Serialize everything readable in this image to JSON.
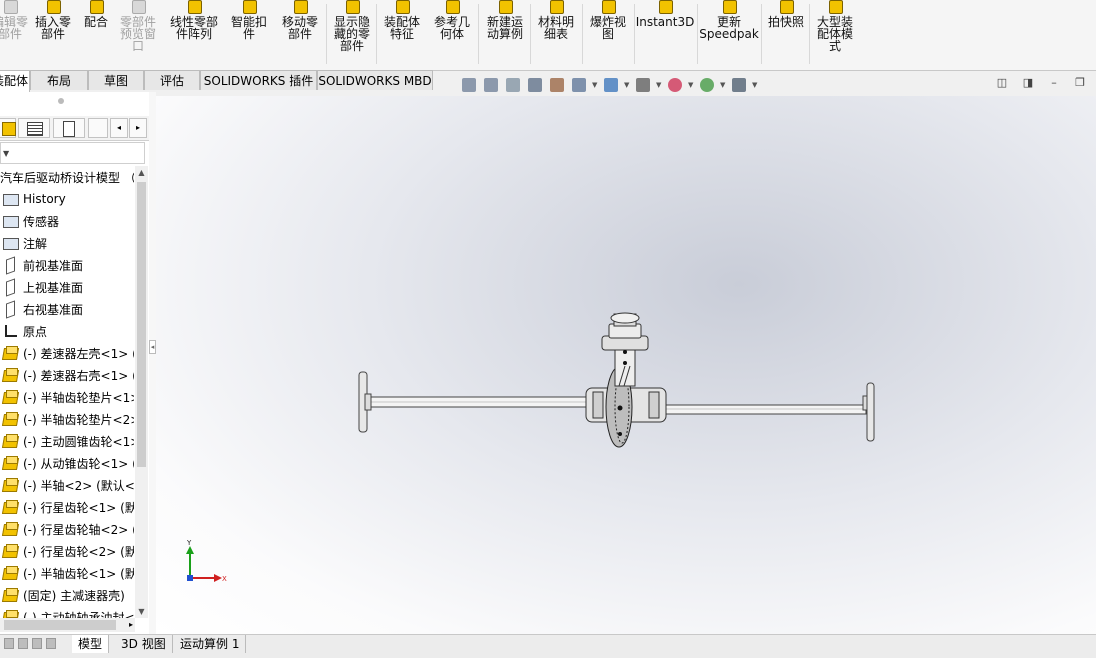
{
  "ribbon": {
    "buttons": [
      {
        "label": "编辑零\n部件",
        "icon": "edit-component-icon",
        "enabled": false
      },
      {
        "label": "插入零\n部件",
        "icon": "insert-component-icon",
        "enabled": true
      },
      {
        "label": "配合",
        "icon": "mate-icon",
        "enabled": true
      },
      {
        "label": "零部件\n预览窗\n口",
        "icon": "component-preview-icon",
        "enabled": false
      },
      {
        "label": "线性零部\n件阵列",
        "icon": "linear-pattern-icon",
        "enabled": true
      },
      {
        "label": "智能扣\n件",
        "icon": "smart-fasteners-icon",
        "enabled": true
      },
      {
        "label": "移动零\n部件",
        "icon": "move-component-icon",
        "enabled": true
      },
      {
        "label": "显示隐\n藏的零\n部件",
        "icon": "show-hidden-icon",
        "enabled": true
      },
      {
        "label": "装配体\n特征",
        "icon": "assembly-features-icon",
        "enabled": true
      },
      {
        "label": "参考几\n何体",
        "icon": "reference-geometry-icon",
        "enabled": true
      },
      {
        "label": "新建运\n动算例",
        "icon": "motion-study-icon",
        "enabled": true
      },
      {
        "label": "材料明\n细表",
        "icon": "bom-icon",
        "enabled": true
      },
      {
        "label": "爆炸视\n图",
        "icon": "exploded-view-icon",
        "enabled": true
      },
      {
        "label": "Instant3D",
        "icon": "instant3d-icon",
        "enabled": true
      },
      {
        "label": "更新\nSpeedpak",
        "icon": "speedpak-icon",
        "enabled": true
      },
      {
        "label": "拍快照",
        "icon": "snapshot-icon",
        "enabled": true
      },
      {
        "label": "大型装\n配体模\n式",
        "icon": "large-assembly-icon",
        "enabled": true
      }
    ]
  },
  "tabs": [
    "装配体",
    "布局",
    "草图",
    "评估",
    "SOLIDWORKS 插件",
    "SOLIDWORKS MBD"
  ],
  "hud_icons": [
    "zoom-to-fit-icon",
    "zoom-area-icon",
    "previous-view-icon",
    "section-view-icon",
    "dynamic-annotation-icon",
    "view-orientation-icon",
    "display-style-icon",
    "hide-show-icon",
    "edit-appearance-icon",
    "apply-scene-icon",
    "view-settings-icon"
  ],
  "tree": {
    "root": "汽车后驱动桥设计模型 （",
    "items": [
      {
        "label": "History",
        "icon": "history-icon"
      },
      {
        "label": "传感器",
        "icon": "sensor-icon"
      },
      {
        "label": "注解",
        "icon": "annotation-icon"
      },
      {
        "label": "前视基准面",
        "icon": "plane-icon"
      },
      {
        "label": "上视基准面",
        "icon": "plane-icon"
      },
      {
        "label": "右视基准面",
        "icon": "plane-icon"
      },
      {
        "label": "原点",
        "icon": "origin-icon"
      },
      {
        "label": "(-) 差速器左壳<1> (",
        "icon": "part-icon"
      },
      {
        "label": "(-) 差速器右壳<1> (",
        "icon": "part-icon"
      },
      {
        "label": "(-) 半轴齿轮垫片<1>",
        "icon": "part-icon"
      },
      {
        "label": "(-) 半轴齿轮垫片<2>",
        "icon": "part-icon"
      },
      {
        "label": "(-) 主动圆锥齿轮<1>",
        "icon": "part-icon"
      },
      {
        "label": "(-) 从动锥齿轮<1> (",
        "icon": "part-icon"
      },
      {
        "label": "(-) 半轴<2> (默认<",
        "icon": "part-icon"
      },
      {
        "label": "(-) 行星齿轮<1> (默",
        "icon": "part-icon"
      },
      {
        "label": "(-) 行星齿轮轴<2> (",
        "icon": "part-icon"
      },
      {
        "label": "(-) 行星齿轮<2> (默",
        "icon": "part-icon"
      },
      {
        "label": "(-) 半轴齿轮<1> (默",
        "icon": "part-icon"
      },
      {
        "label": "(固定) 主减速器壳)",
        "icon": "part-icon"
      },
      {
        "label": "(-) 主动轴轴承油封<",
        "icon": "part-icon"
      }
    ]
  },
  "triad": {
    "x": "X",
    "y": "Y"
  },
  "bottom_tabs": [
    "模型",
    "3D 视图",
    "运动算例 1"
  ],
  "colors": {
    "accent_yellow": "#f2c200",
    "view_bg": "#e6e8ee"
  }
}
